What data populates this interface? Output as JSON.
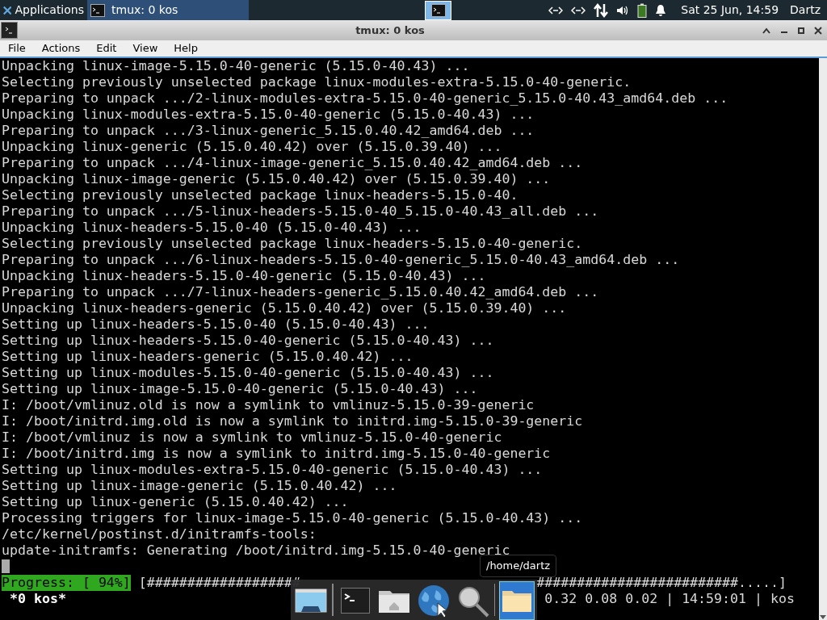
{
  "panel": {
    "menu": "Applications",
    "task": {
      "title": "tmux: 0 kos",
      "selected": true
    },
    "clock": "Sat 25 Jun, 14:59",
    "user": "Dartz"
  },
  "window": {
    "title": "tmux: 0 kos"
  },
  "menu": [
    "File",
    "Actions",
    "Edit",
    "View",
    "Help"
  ],
  "terminal": {
    "lines": [
      "Unpacking linux-image-5.15.0-40-generic (5.15.0-40.43) ...",
      "Selecting previously unselected package linux-modules-extra-5.15.0-40-generic.",
      "Preparing to unpack .../2-linux-modules-extra-5.15.0-40-generic_5.15.0-40.43_amd64.deb ...",
      "Unpacking linux-modules-extra-5.15.0-40-generic (5.15.0-40.43) ...",
      "Preparing to unpack .../3-linux-generic_5.15.0.40.42_amd64.deb ...",
      "Unpacking linux-generic (5.15.0.40.42) over (5.15.0.39.40) ...",
      "Preparing to unpack .../4-linux-image-generic_5.15.0.40.42_amd64.deb ...",
      "Unpacking linux-image-generic (5.15.0.40.42) over (5.15.0.39.40) ...",
      "Selecting previously unselected package linux-headers-5.15.0-40.",
      "Preparing to unpack .../5-linux-headers-5.15.0-40_5.15.0-40.43_all.deb ...",
      "Unpacking linux-headers-5.15.0-40 (5.15.0-40.43) ...",
      "Selecting previously unselected package linux-headers-5.15.0-40-generic.",
      "Preparing to unpack .../6-linux-headers-5.15.0-40-generic_5.15.0-40.43_amd64.deb ...",
      "Unpacking linux-headers-5.15.0-40-generic (5.15.0-40.43) ...",
      "Preparing to unpack .../7-linux-headers-generic_5.15.0.40.42_amd64.deb ...",
      "Unpacking linux-headers-generic (5.15.0.40.42) over (5.15.0.39.40) ...",
      "Setting up linux-headers-5.15.0-40 (5.15.0-40.43) ...",
      "Setting up linux-headers-5.15.0-40-generic (5.15.0-40.43) ...",
      "Setting up linux-headers-generic (5.15.0.40.42) ...",
      "Setting up linux-modules-5.15.0-40-generic (5.15.0-40.43) ...",
      "Setting up linux-image-5.15.0-40-generic (5.15.0-40.43) ...",
      "I: /boot/vmlinuz.old is now a symlink to vmlinuz-5.15.0-39-generic",
      "I: /boot/initrd.img.old is now a symlink to initrd.img-5.15.0-39-generic",
      "I: /boot/vmlinuz is now a symlink to vmlinuz-5.15.0-40-generic",
      "I: /boot/initrd.img is now a symlink to initrd.img-5.15.0-40-generic",
      "Setting up linux-modules-extra-5.15.0-40-generic (5.15.0-40.43) ...",
      "Setting up linux-image-generic (5.15.0.40.42) ...",
      "Setting up linux-generic (5.15.0.40.42) ...",
      "Processing triggers for linux-image-5.15.0-40-generic (5.15.0-40.43) ...",
      "/etc/kernel/postinst.d/initramfs-tools:",
      "update-initramfs: Generating /boot/initrd.img-5.15.0-40-generic"
    ],
    "progress": {
      "label": "Progress: [ 94%]",
      "bar_left": "[###################",
      "bar_right": "#########################.....]"
    },
    "status_left": "*0 kos*",
    "status_right": "0.32 0.08 0.02 | 14:59:01 | kos"
  },
  "tooltip": "/home/dartz",
  "dock": [
    {
      "kind": "desktop",
      "selected": false
    },
    {
      "kind": "divider"
    },
    {
      "kind": "terminal",
      "selected": false
    },
    {
      "kind": "home",
      "selected": false
    },
    {
      "kind": "globe",
      "selected": false
    },
    {
      "kind": "search",
      "selected": false
    },
    {
      "kind": "divider"
    },
    {
      "kind": "folder",
      "selected": true
    }
  ]
}
